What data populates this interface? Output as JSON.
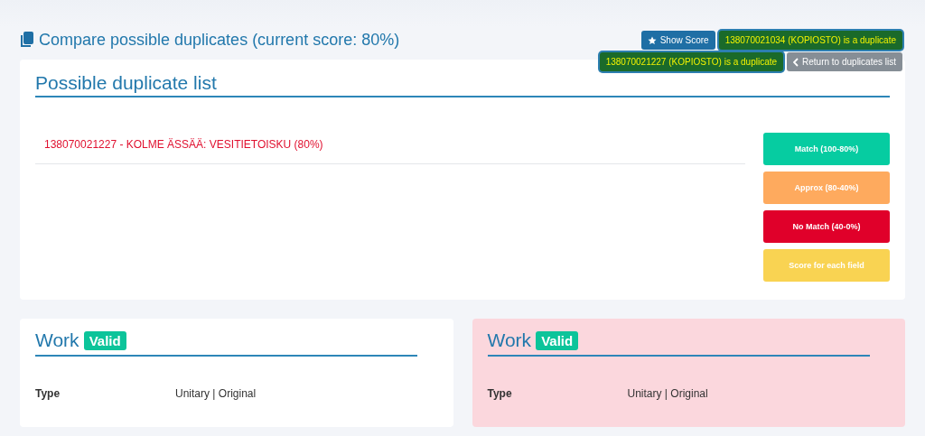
{
  "header": {
    "title": "Compare possible duplicates (current score: 80%)"
  },
  "actions": [
    {
      "label": "Show Score",
      "kind": "score",
      "highlighted": false
    },
    {
      "label": "138070021034 (KOPIOSTO) is a duplicate",
      "kind": "plain",
      "highlighted": true
    },
    {
      "label": "138070021227 (KOPIOSTO) is a duplicate",
      "kind": "plain",
      "highlighted": true
    },
    {
      "label": "Return to duplicates list",
      "kind": "back",
      "highlighted": false
    }
  ],
  "duplicate_list": {
    "title": "Possible duplicate list",
    "items": [
      {
        "label": "138070021227 - KOLME ÄSSÄÄ: VESITIETOISKU (80%)",
        "color": "#e0102f"
      }
    ],
    "legend": [
      {
        "label": "Match (100-80%)",
        "color": "#06cca1"
      },
      {
        "label": "Approx (80-40%)",
        "color": "#feaa5e"
      },
      {
        "label": "No Match (40-0%)",
        "color": "#e0002a"
      },
      {
        "label": "Score for each field",
        "color": "#f9d352"
      }
    ]
  },
  "works": [
    {
      "title": "Work",
      "badge": "Valid",
      "mismatch": false,
      "fields": [
        {
          "label": "Type",
          "value": "Unitary | Original"
        }
      ]
    },
    {
      "title": "Work",
      "badge": "Valid",
      "mismatch": true,
      "fields": [
        {
          "label": "Type",
          "value": "Unitary | Original"
        }
      ]
    }
  ]
}
